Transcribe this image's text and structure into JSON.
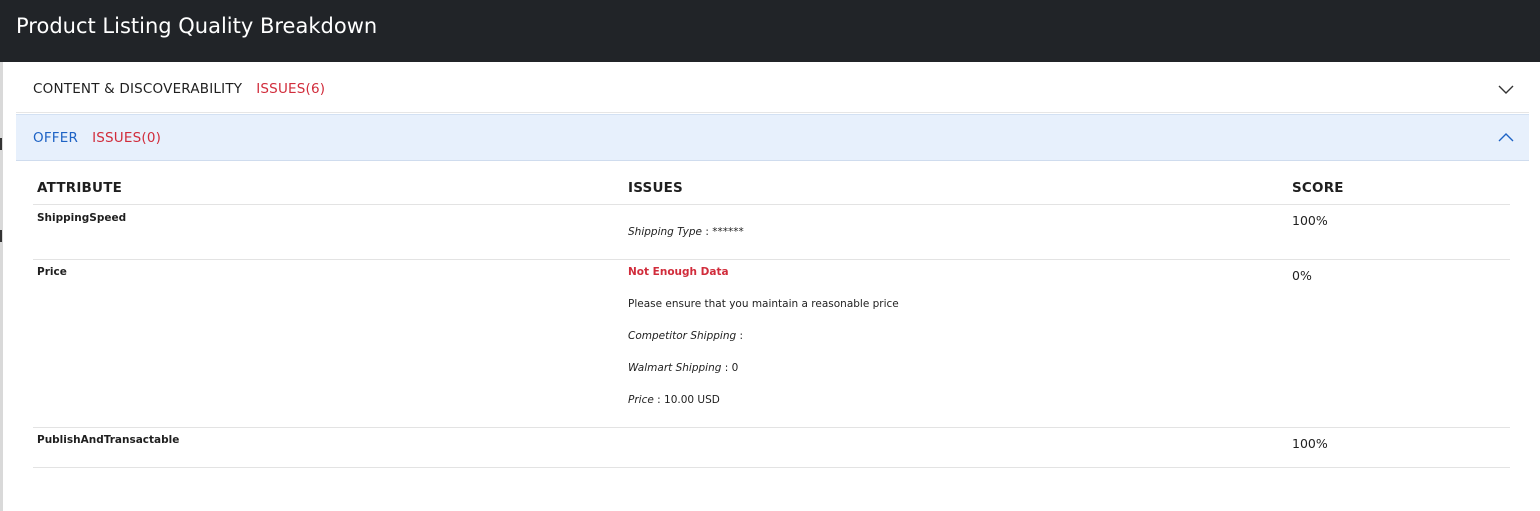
{
  "modal": {
    "title": "Product Listing Quality Breakdown"
  },
  "sections": [
    {
      "name": "CONTENT & DISCOVERABILITY",
      "issues": "ISSUES(6)",
      "state": "collapsed",
      "chevron_icon": "chevron-down-icon"
    },
    {
      "name": "OFFER",
      "issues": "ISSUES(0)",
      "state": "expanded",
      "chevron_icon": "chevron-up-icon"
    }
  ],
  "table": {
    "headers": {
      "attribute": "ATTRIBUTE",
      "issues": "ISSUES",
      "score": "SCORE"
    },
    "rows": [
      {
        "attribute": "ShippingSpeed",
        "score": "100%",
        "issue_lines": [
          {
            "label": "Shipping Type",
            "sep": " : ",
            "value": "******"
          }
        ]
      },
      {
        "attribute": "Price",
        "score": "0%",
        "issue_status": "Not Enough Data",
        "issue_message": "Please ensure that you maintain a reasonable price",
        "issue_lines": [
          {
            "label": "Competitor Shipping",
            "sep": " :",
            "value": ""
          },
          {
            "label": "Walmart Shipping",
            "sep": " : ",
            "value": "0"
          },
          {
            "label": "Price",
            "sep": " : ",
            "value": "10.00 USD"
          }
        ]
      },
      {
        "attribute": "PublishAndTransactable",
        "score": "100%"
      }
    ]
  },
  "colors": {
    "header_bg": "#212428",
    "accent_blue": "#1e63c5",
    "issue_red": "#d12c3b",
    "expanded_bg": "#e7f0fc"
  }
}
